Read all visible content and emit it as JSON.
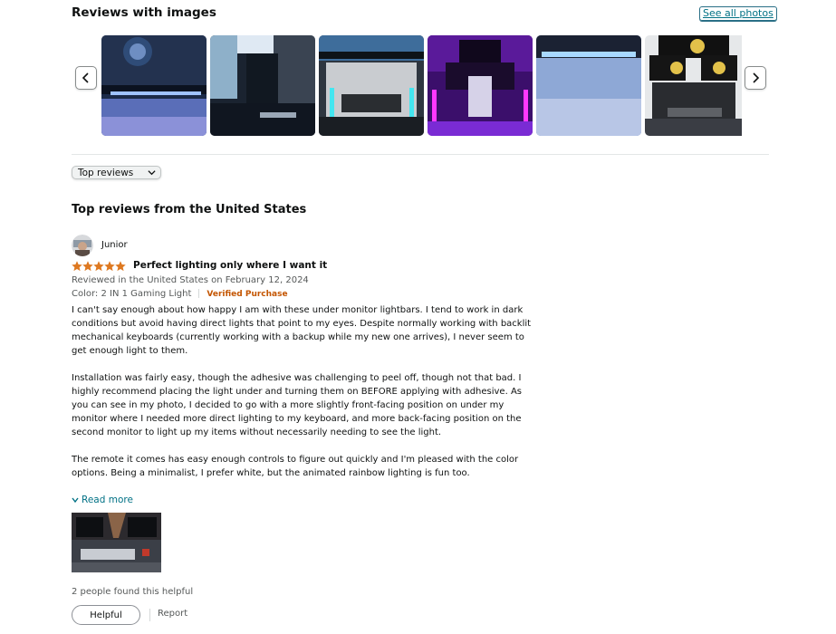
{
  "images_section": {
    "title": "Reviews with images",
    "see_all": "See all photos",
    "prev_icon": "chevron-left-icon",
    "next_icon": "chevron-right-icon"
  },
  "sort": {
    "selected": "Top reviews"
  },
  "top_reviews_title": "Top reviews from the United States",
  "review": {
    "reviewer": "Junior",
    "rating": 5,
    "title": "Perfect lighting only where I want it",
    "date_line": "Reviewed in the United States on February 12, 2024",
    "variant": "Color: 2 IN 1 Gaming Light",
    "verified": "Verified Purchase",
    "paragraphs": [
      "I can't say enough about how happy I am with these under monitor lightbars. I tend to work in dark conditions but avoid having direct lights that point to my eyes. Despite normally working with backlit mechanical keyboards (currently working with a backup while my new one arrives), I never seem to get enough light to them.",
      "Installation was fairly easy, though the adhesive was challenging to peel off, though not that bad. I highly recommend placing the light under and turning them on BEFORE applying with adhesive. As you can see in my photo, I decided to go with a more slightly front-facing position on under my monitor where I needed more direct lighting to my keyboard, and more back-facing position on the second monitor to light up my items without necessarily needing to see the light.",
      "The remote it comes has easy enough controls to figure out quickly and I'm pleased with the color options. Being a minimalist, I prefer white, but the animated rainbow lighting is fun too."
    ],
    "read_more": "Read more",
    "helpful_count_text": "2 people found this helpful",
    "helpful_button": "Helpful",
    "report": "Report"
  },
  "colors": {
    "link": "#007185",
    "star": "#de7921",
    "verified": "#c45500"
  }
}
